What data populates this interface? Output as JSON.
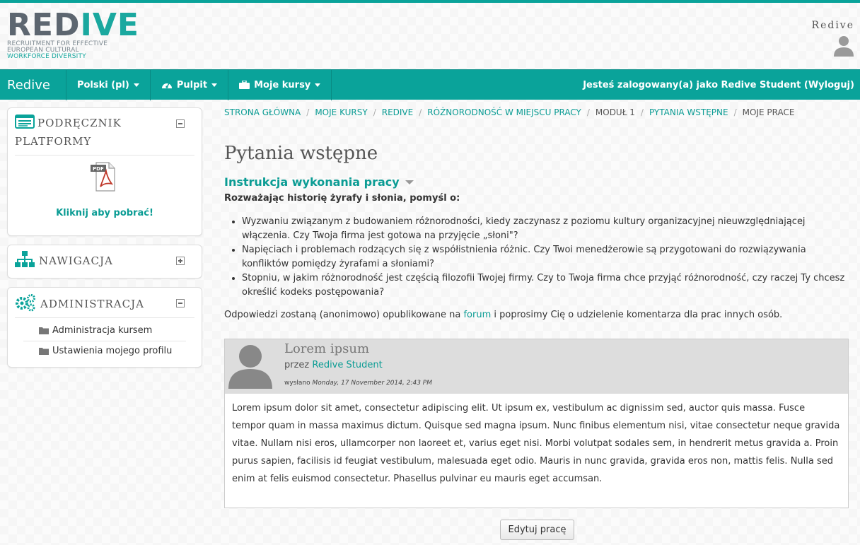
{
  "header": {
    "logo_text_main": "RED",
    "logo_text_accent": "IVE",
    "logo_sub1": "Recruitment for effective",
    "logo_sub2": "European Cultural",
    "logo_sub3": "Workforce Diversity",
    "user_name": "Redive"
  },
  "navbar": {
    "brand": "Redive",
    "language": "Polski (pl)",
    "dashboard": "Pulpit",
    "my_courses": "Moje kursy",
    "login_info": "Jesteś zalogowany(a) jako Redive Student (Wyloguj)"
  },
  "sidebar": {
    "manual_title": "PODRĘCZNIK PLATFORMY",
    "download_label": "Kliknij aby pobrać!",
    "nav_title": "NAWIGACJA",
    "admin_title": "ADMINISTRACJA",
    "admin_items": [
      "Administracja kursem",
      "Ustawienia mojego profilu"
    ]
  },
  "breadcrumb": [
    "Strona główna",
    "Moje kursy",
    "REDIVE",
    "Różnorodność w miejscu pracy",
    "Moduł 1",
    "Pytania wstępne",
    "Moje prace"
  ],
  "page": {
    "title": "Pytania wstępne",
    "instructions_title": "Instrukcja wykonania pracy",
    "lead": "Rozważając historię żyrafy i słonia, pomyśl o:",
    "bullets": [
      "Wyzwaniu związanym z budowaniem różnorodności, kiedy zaczynasz z poziomu kultury organizacyjnej nieuwzględniającej włączenia. Czy Twoja firma jest gotowa na przyjęcie „słoni\"?",
      "Napięciach i problemach rodzących się z współistnienia różnic. Czy Twoi menedżerowie są przygotowani do rozwiązywania konfliktów pomiędzy żyrafami a słoniami?",
      "Stopniu, w jakim różnorodność jest częścią filozofii Twojej firmy. Czy to Twoja firma chce przyjąć różnorodność, czy raczej Ty chcesz określić kodeks postępowania?"
    ],
    "answers_before": "Odpowiedzi zostaną (anonimowo) opublikowane na ",
    "answers_link": "forum",
    "answers_after": " i poprosimy Cię o udzielenie komentarza dla prac innych osób."
  },
  "post": {
    "title": "Lorem ipsum",
    "by_label": "przez ",
    "author": "Redive Student",
    "date_label": "wysłano ",
    "date": "Monday, 17 November 2014, 2:43 PM",
    "body": "Lorem ipsum dolor sit amet, consectetur adipiscing elit. Ut ipsum ex, vestibulum ac dignissim sed, auctor quis massa. Fusce tempor quam in massa maximus dictum. Quisque sed magna ipsum. Nunc finibus elementum nisi, vitae consectetur neque gravida vitae. Nullam nisi eros, ullamcorper non laoreet et, varius eget nisi. Morbi volutpat sodales sem, in hendrerit metus gravida a. Proin purus sapien, facilisis id feugiat vestibulum, malesuada eget odio. Mauris in nunc gravida, gravida eros non, mattis felis. Nulla sed enim at felis euismod consectetur. Phasellus pulvinar eu mauris eget accumsan."
  },
  "edit_button": "Edytuj pracę",
  "colors": {
    "accent": "#0aa39a",
    "link": "#0b9c94"
  },
  "icons": [
    "user-icon",
    "dashboard-icon",
    "briefcase-icon",
    "book-icon",
    "pdf-icon",
    "sitemap-icon",
    "gears-icon",
    "folder-icon",
    "avatar-icon"
  ]
}
